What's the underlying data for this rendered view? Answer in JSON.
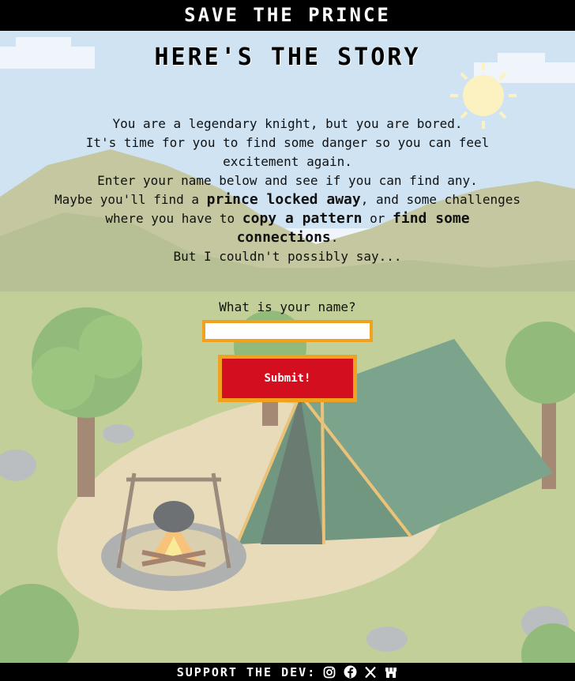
{
  "header": {
    "title": "SAVE THE PRINCE"
  },
  "main": {
    "heading": "HERE'S THE STORY",
    "story": {
      "line1": "You are a legendary knight, but you are bored.",
      "line2": "It's time for you to find some danger so you can feel excitement again.",
      "line3": "Enter your name below and see if you can find any.",
      "line4_pre": "Maybe you'll find a ",
      "line4_bold": "prince locked away",
      "line4_post": ", and some challenges where you have to ",
      "line4_bold2": "copy a pattern",
      "line4_mid": " or ",
      "line4_bold3": "find some connections",
      "line4_end": ".",
      "line5": "But I couldn't possibly say..."
    },
    "form": {
      "name_label": "What is your name?",
      "name_value": "",
      "submit_label": "Submit!"
    }
  },
  "footer": {
    "label": "SUPPORT THE DEV:",
    "icons": [
      "instagram-icon",
      "facebook-icon",
      "x-icon",
      "shop-icon"
    ]
  },
  "colors": {
    "bar": "#000000",
    "accent": "#f0a21f",
    "button": "#d30e1e"
  }
}
